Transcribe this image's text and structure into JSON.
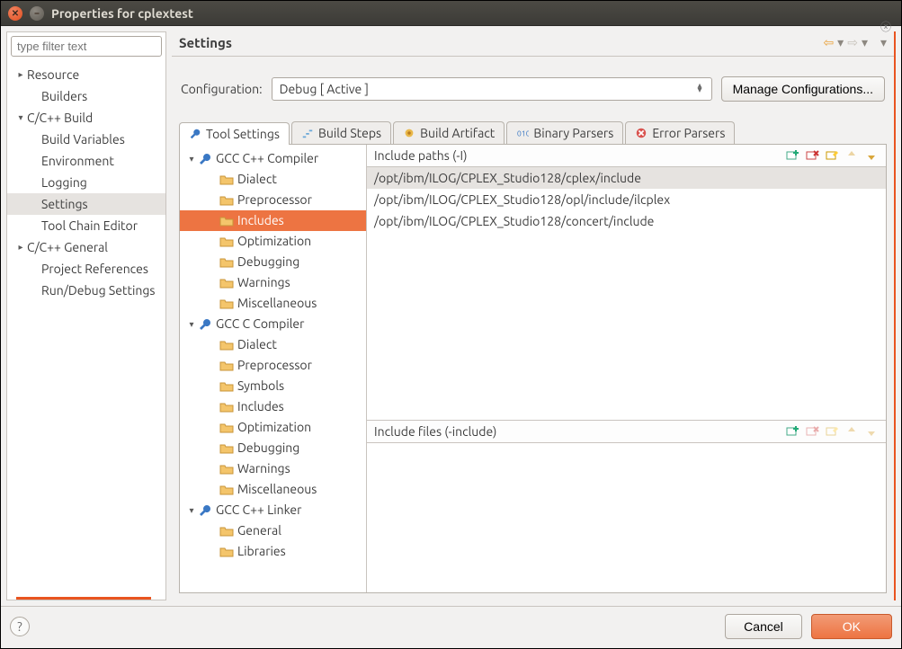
{
  "window": {
    "title": "Properties for cplextest"
  },
  "sidebar": {
    "filter_placeholder": "type filter text",
    "items": [
      {
        "label": "Resource",
        "depth": 0,
        "tw": "▸"
      },
      {
        "label": "Builders",
        "depth": 1,
        "tw": ""
      },
      {
        "label": "C/C++ Build",
        "depth": 0,
        "tw": "▾"
      },
      {
        "label": "Build Variables",
        "depth": 1,
        "tw": ""
      },
      {
        "label": "Environment",
        "depth": 1,
        "tw": ""
      },
      {
        "label": "Logging",
        "depth": 1,
        "tw": ""
      },
      {
        "label": "Settings",
        "depth": 1,
        "tw": "",
        "selected": true
      },
      {
        "label": "Tool Chain Editor",
        "depth": 1,
        "tw": ""
      },
      {
        "label": "C/C++ General",
        "depth": 0,
        "tw": "▸"
      },
      {
        "label": "Project References",
        "depth": 1,
        "tw": ""
      },
      {
        "label": "Run/Debug Settings",
        "depth": 1,
        "tw": ""
      }
    ]
  },
  "detail": {
    "title": "Settings",
    "config_label": "Configuration:",
    "config_value": "Debug  [ Active ]",
    "manage_label": "Manage Configurations...",
    "tabs": [
      {
        "label": "Tool Settings",
        "icon": "wrench",
        "active": true
      },
      {
        "label": "Build Steps",
        "icon": "steps",
        "active": false
      },
      {
        "label": "Build Artifact",
        "icon": "artifact",
        "active": false
      },
      {
        "label": "Binary Parsers",
        "icon": "binary",
        "active": false
      },
      {
        "label": "Error Parsers",
        "icon": "error",
        "active": false
      }
    ],
    "tool_tree": [
      {
        "label": "GCC C++ Compiler",
        "depth": 0,
        "tw": "▾",
        "icon": "wrench"
      },
      {
        "label": "Dialect",
        "depth": 1,
        "tw": "",
        "icon": "folder"
      },
      {
        "label": "Preprocessor",
        "depth": 1,
        "tw": "",
        "icon": "folder"
      },
      {
        "label": "Includes",
        "depth": 1,
        "tw": "",
        "icon": "folder",
        "selected": true
      },
      {
        "label": "Optimization",
        "depth": 1,
        "tw": "",
        "icon": "folder"
      },
      {
        "label": "Debugging",
        "depth": 1,
        "tw": "",
        "icon": "folder"
      },
      {
        "label": "Warnings",
        "depth": 1,
        "tw": "",
        "icon": "folder"
      },
      {
        "label": "Miscellaneous",
        "depth": 1,
        "tw": "",
        "icon": "folder"
      },
      {
        "label": "GCC C Compiler",
        "depth": 0,
        "tw": "▾",
        "icon": "wrench"
      },
      {
        "label": "Dialect",
        "depth": 1,
        "tw": "",
        "icon": "folder"
      },
      {
        "label": "Preprocessor",
        "depth": 1,
        "tw": "",
        "icon": "folder"
      },
      {
        "label": "Symbols",
        "depth": 1,
        "tw": "",
        "icon": "folder"
      },
      {
        "label": "Includes",
        "depth": 1,
        "tw": "",
        "icon": "folder"
      },
      {
        "label": "Optimization",
        "depth": 1,
        "tw": "",
        "icon": "folder"
      },
      {
        "label": "Debugging",
        "depth": 1,
        "tw": "",
        "icon": "folder"
      },
      {
        "label": "Warnings",
        "depth": 1,
        "tw": "",
        "icon": "folder"
      },
      {
        "label": "Miscellaneous",
        "depth": 1,
        "tw": "",
        "icon": "folder"
      },
      {
        "label": "GCC C++ Linker",
        "depth": 0,
        "tw": "▾",
        "icon": "wrench"
      },
      {
        "label": "General",
        "depth": 1,
        "tw": "",
        "icon": "folder"
      },
      {
        "label": "Libraries",
        "depth": 1,
        "tw": "",
        "icon": "folder"
      }
    ],
    "panes": {
      "include_paths": {
        "title": "Include paths (-I)",
        "rows": [
          {
            "value": "/opt/ibm/ILOG/CPLEX_Studio128/cplex/include",
            "selected": true
          },
          {
            "value": "/opt/ibm/ILOG/CPLEX_Studio128/opl/include/ilcplex"
          },
          {
            "value": "/opt/ibm/ILOG/CPLEX_Studio128/concert/include"
          }
        ]
      },
      "include_files": {
        "title": "Include files (-include)",
        "rows": []
      }
    }
  },
  "buttons": {
    "help": "?",
    "cancel": "Cancel",
    "ok": "OK"
  }
}
